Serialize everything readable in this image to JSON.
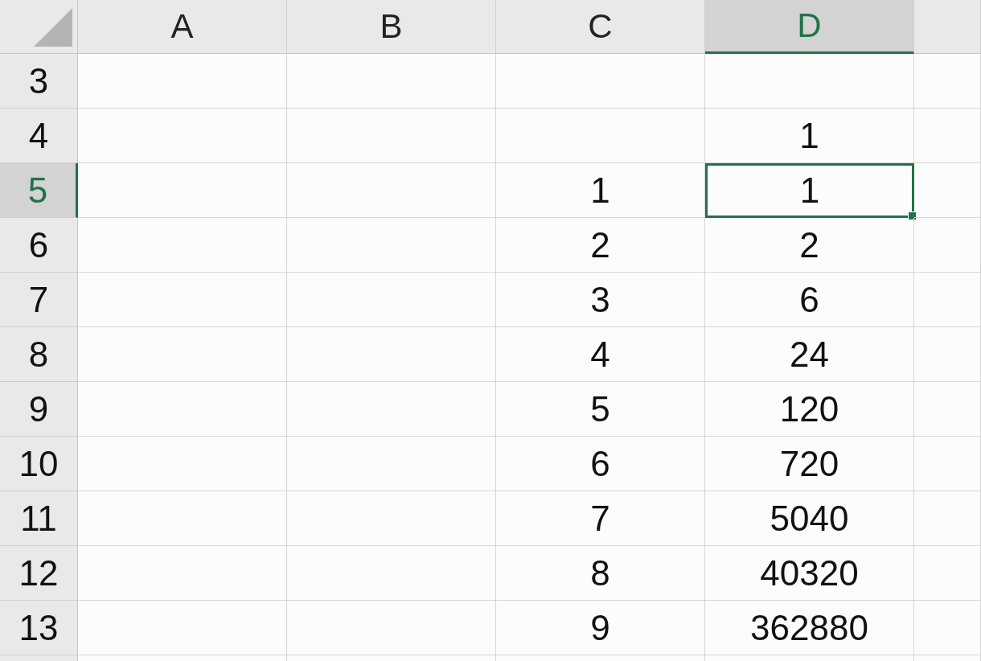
{
  "columns": [
    {
      "label": "A",
      "selected": false
    },
    {
      "label": "B",
      "selected": false
    },
    {
      "label": "C",
      "selected": false
    },
    {
      "label": "D",
      "selected": true
    }
  ],
  "rows": [
    {
      "header": "3",
      "selected": false
    },
    {
      "header": "4",
      "selected": false,
      "d": {
        "value": "1",
        "selected": false
      }
    },
    {
      "header": "5",
      "selected": true,
      "c": {
        "value": "1",
        "selected": false
      },
      "d": {
        "value": "1",
        "selected": true
      }
    },
    {
      "header": "6",
      "selected": false,
      "c": {
        "value": "2",
        "selected": false
      },
      "d": {
        "value": "2",
        "selected": false
      }
    },
    {
      "header": "7",
      "selected": false,
      "c": {
        "value": "3",
        "selected": false
      },
      "d": {
        "value": "6",
        "selected": false
      }
    },
    {
      "header": "8",
      "selected": false,
      "c": {
        "value": "4",
        "selected": false
      },
      "d": {
        "value": "24",
        "selected": false
      }
    },
    {
      "header": "9",
      "selected": false,
      "c": {
        "value": "5",
        "selected": false
      },
      "d": {
        "value": "120",
        "selected": false
      }
    },
    {
      "header": "10",
      "selected": false,
      "c": {
        "value": "6",
        "selected": false
      },
      "d": {
        "value": "720",
        "selected": false
      }
    },
    {
      "header": "11",
      "selected": false,
      "c": {
        "value": "7",
        "selected": false
      },
      "d": {
        "value": "5040",
        "selected": false
      }
    },
    {
      "header": "12",
      "selected": false,
      "c": {
        "value": "8",
        "selected": false
      },
      "d": {
        "value": "40320",
        "selected": false
      }
    },
    {
      "header": "13",
      "selected": false,
      "c": {
        "value": "9",
        "selected": false
      },
      "d": {
        "value": "362880",
        "selected": false
      }
    }
  ]
}
